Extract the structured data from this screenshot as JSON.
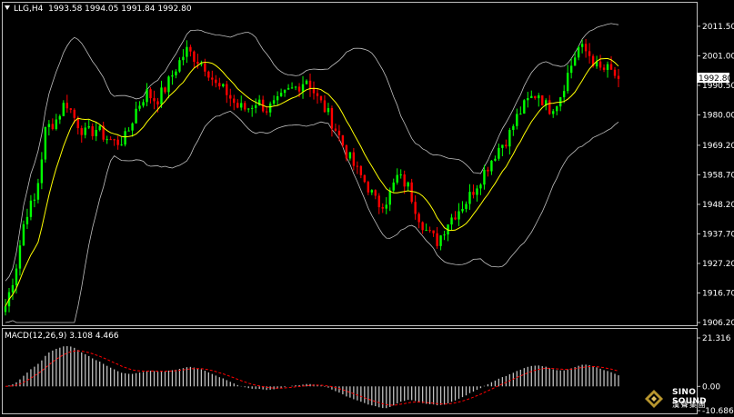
{
  "header": {
    "symbol": "LLG,H4",
    "quote": "1993.58 1994.05 1991.84 1992.80"
  },
  "price_axis": {
    "ticks": [
      "2011.50",
      "2001.00",
      "1990.50",
      "1980.00",
      "1969.20",
      "1958.70",
      "1948.20",
      "1937.70",
      "1927.20",
      "1916.70",
      "1906.20"
    ],
    "current_label": "1992.80"
  },
  "macd": {
    "label": "MACD(12,26,9) 3.108 4.466",
    "ticks": [
      "21.316",
      "0.00",
      "-10.686"
    ]
  },
  "logo": {
    "brand": "SINO SOUND",
    "chinese": "漢聲集團"
  },
  "colors": {
    "background": "#000000",
    "bull_candle": "#00ff00",
    "bear_candle": "#ff0000",
    "ma_line": "#ffff00",
    "bands": "#c0c0c0",
    "macd_hist": "#c0c0c0",
    "macd_signal": "#ff0000"
  },
  "chart_data": {
    "type": "candlestick",
    "instrument": "LLG",
    "timeframe": "H4",
    "last_price": 1992.8,
    "ylim": [
      1906.2,
      2016.0
    ],
    "approx_close_path": [
      1912,
      1925,
      1945,
      1950,
      1975,
      1978,
      1985,
      1978,
      1973,
      1975,
      1972,
      1970,
      1972,
      1982,
      1988,
      1985,
      1990,
      1997,
      2003,
      2000,
      1997,
      1990,
      1988,
      1983,
      1982,
      1985,
      1982,
      1984,
      1988,
      1990,
      1993,
      1986,
      1981,
      1974,
      1966,
      1960,
      1955,
      1948,
      1950,
      1958,
      1955,
      1945,
      1938,
      1935,
      1942,
      1946,
      1950,
      1956,
      1962,
      1968,
      1972,
      1980,
      1985,
      1988,
      1982,
      1985,
      1995,
      2004,
      2002,
      1996,
      1996,
      1993
    ],
    "indicators": {
      "moving_average": "yellow",
      "bollinger_bands": "grey",
      "macd": {
        "params": "12,26,9",
        "main": 3.108,
        "signal": 4.466,
        "ylim": [
          -10.686,
          21.316
        ]
      }
    }
  }
}
